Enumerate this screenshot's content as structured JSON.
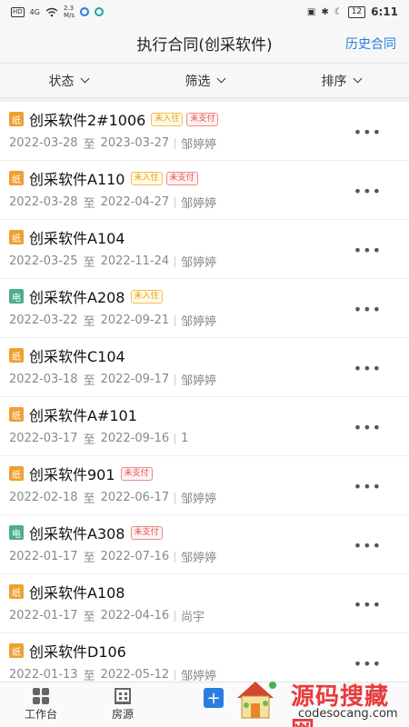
{
  "statusbar": {
    "hd": "HD",
    "signal": "4G",
    "speed_value": "2.3",
    "speed_unit": "M/s",
    "battery": "12",
    "time": "6:11"
  },
  "header": {
    "title": "执行合同(创采软件)",
    "history_link": "历史合同"
  },
  "filters": {
    "status": "状态",
    "filter": "筛选",
    "sort": "排序"
  },
  "contracts": [
    {
      "type": "纸",
      "type_color": "#f0a030",
      "name": "创采软件2#1006",
      "tags": [
        "未入住",
        "未支付"
      ],
      "start": "2022-03-28",
      "to": "至",
      "end": "2023-03-27",
      "person": "邹婷婷"
    },
    {
      "type": "纸",
      "type_color": "#f0a030",
      "name": "创采软件A110",
      "tags": [
        "未入住",
        "未支付"
      ],
      "start": "2022-03-28",
      "to": "至",
      "end": "2022-04-27",
      "person": "邹婷婷"
    },
    {
      "type": "纸",
      "type_color": "#f0a030",
      "name": "创采软件A104",
      "tags": [],
      "start": "2022-03-25",
      "to": "至",
      "end": "2022-11-24",
      "person": "邹婷婷"
    },
    {
      "type": "电",
      "type_color": "#4caf8a",
      "name": "创采软件A208",
      "tags": [
        "未入住"
      ],
      "start": "2022-03-22",
      "to": "至",
      "end": "2022-09-21",
      "person": "邹婷婷"
    },
    {
      "type": "纸",
      "type_color": "#f0a030",
      "name": "创采软件C104",
      "tags": [],
      "start": "2022-03-18",
      "to": "至",
      "end": "2022-09-17",
      "person": "邹婷婷"
    },
    {
      "type": "纸",
      "type_color": "#f0a030",
      "name": "创采软件A#101",
      "tags": [],
      "start": "2022-03-17",
      "to": "至",
      "end": "2022-09-16",
      "person": "1"
    },
    {
      "type": "纸",
      "type_color": "#f0a030",
      "name": "创采软件901",
      "tags": [
        "未支付"
      ],
      "start": "2022-02-18",
      "to": "至",
      "end": "2022-06-17",
      "person": "邹婷婷"
    },
    {
      "type": "电",
      "type_color": "#4caf8a",
      "name": "创采软件A308",
      "tags": [
        "未支付"
      ],
      "start": "2022-01-17",
      "to": "至",
      "end": "2022-07-16",
      "person": "邹婷婷"
    },
    {
      "type": "纸",
      "type_color": "#f0a030",
      "name": "创采软件A108",
      "tags": [],
      "start": "2022-01-17",
      "to": "至",
      "end": "2022-04-16",
      "person": "尚宇"
    },
    {
      "type": "纸",
      "type_color": "#f0a030",
      "name": "创采软件D106",
      "tags": [],
      "start": "2022-01-13",
      "to": "至",
      "end": "2022-05-12",
      "person": "邹婷婷"
    }
  ],
  "more_label": "•••",
  "bottomnav": {
    "workbench": "工作台",
    "listings": "房源",
    "add": "+"
  },
  "watermark": {
    "title": "源码搜藏网",
    "subtitle": "codesocang.com"
  },
  "colors": {
    "accent": "#2a7de1",
    "tag_yellow": "#e5a30f",
    "tag_red": "#e05252"
  }
}
